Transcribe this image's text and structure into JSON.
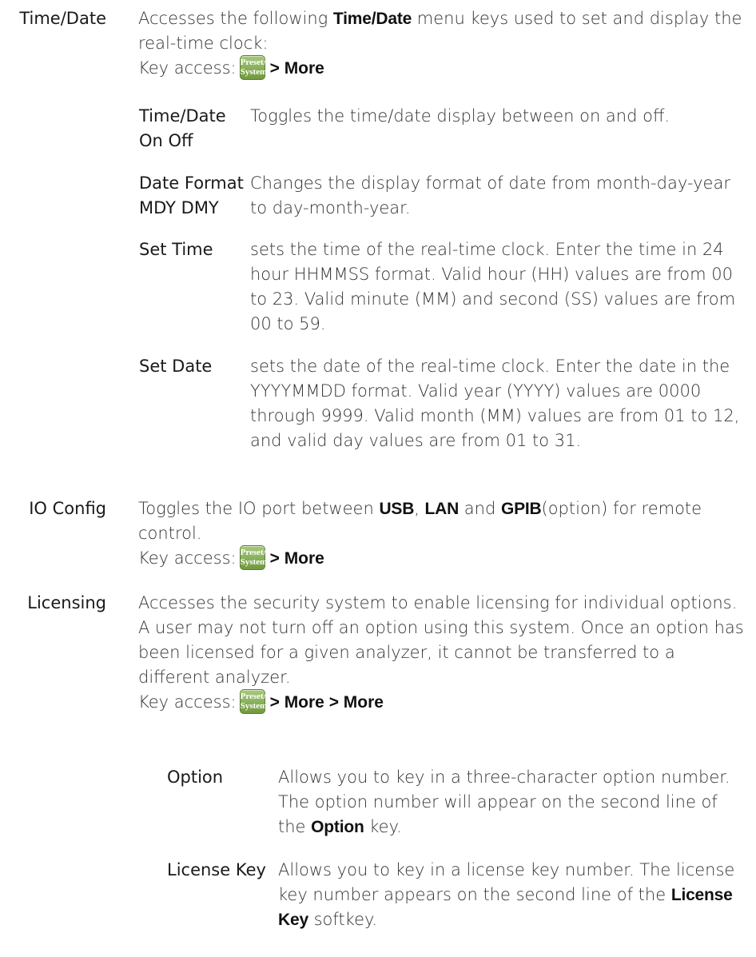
{
  "time_date": {
    "term": "Time/Date",
    "desc_pre": "Accesses the following ",
    "desc_bold": "Time/Date",
    "desc_post": " menu keys used to set and display the real-time clock:",
    "key_access_label": "Key access:",
    "key_cap_line1": "Preset/",
    "key_cap_line2": "System",
    "key_path": "> More",
    "sub": [
      {
        "term_l1": "Time/Date",
        "term_l2": "On Off",
        "desc": "Toggles the time/date display between on and off."
      },
      {
        "term_l1": "Date Format",
        "term_l2": "MDY DMY",
        "desc": "Changes the display format of date from month-day-year to day-month-year."
      },
      {
        "term_l1": "Set Time",
        "term_l2": "",
        "desc": "sets the time of the real-time clock. Enter the time in 24 hour HHMMSS format. Valid hour (HH) values are from 00 to 23. Valid minute (MM) and second (SS) values are from 00 to 59."
      },
      {
        "term_l1": "Set Date",
        "term_l2": "",
        "desc": "sets the date of the real-time clock. Enter the date in the YYYYMMDD format. Valid year (YYYY) values are 0000 through 9999. Valid month (MM) values are from 01 to 12, and valid day values are from 01 to 31."
      }
    ]
  },
  "io_config": {
    "term": "IO Config",
    "desc_1": "Toggles the IO port between ",
    "b1": "USB",
    "desc_2": ", ",
    "b2": "LAN",
    "desc_3": " and ",
    "b3": "GPIB",
    "desc_4": "(option) for remote control.",
    "key_access_label": "Key access:",
    "key_cap_line1": "Preset/",
    "key_cap_line2": "System",
    "key_path": "> More"
  },
  "licensing": {
    "term": "Licensing",
    "desc": "Accesses the security system to enable licensing for individual options. A user may not turn off an option using this system. Once an option has been licensed for a given analyzer, it cannot be transferred to a different analyzer.",
    "key_access_label": "Key access:",
    "key_cap_line1": "Preset/",
    "key_cap_line2": "System",
    "key_path": "> More > More",
    "option": {
      "term": "Option",
      "desc_pre": "Allows you to key in a three-character option number. The option number will appear on the second line of the ",
      "desc_bold": "Option",
      "desc_post": " key."
    },
    "license_key": {
      "term": "License Key",
      "desc_pre": "Allows you to key in a license key number. The license key number appears on the second line of the ",
      "desc_bold": "License Key",
      "desc_post": " softkey."
    }
  }
}
